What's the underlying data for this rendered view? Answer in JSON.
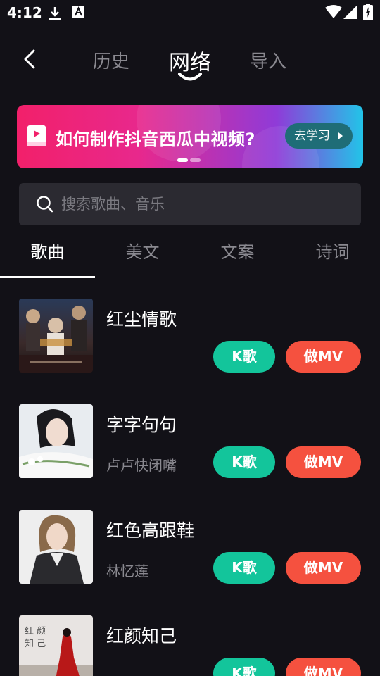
{
  "status_bar": {
    "time": "4:12",
    "icons": [
      "download-icon",
      "font-icon",
      "wifi-icon",
      "signal-icon",
      "battery-charging-icon"
    ]
  },
  "nav": {
    "back_icon": "back-icon",
    "tabs": [
      {
        "label": "历史",
        "active": false
      },
      {
        "label": "网络",
        "active": true
      },
      {
        "label": "导入",
        "active": false
      }
    ]
  },
  "banner": {
    "icon": "book-icon",
    "text": "如何制作抖音西瓜中视频?",
    "button_label": "去学习",
    "page_count": 2,
    "active_page": 1
  },
  "search": {
    "icon": "search-icon",
    "placeholder": "搜索歌曲、音乐"
  },
  "categories": {
    "tabs": [
      {
        "label": "歌曲",
        "active": true
      },
      {
        "label": "美文",
        "active": false
      },
      {
        "label": "文案",
        "active": false
      },
      {
        "label": "诗词",
        "active": false
      }
    ]
  },
  "songs": [
    {
      "title": "红尘情歌",
      "artist": "",
      "k_label": "K歌",
      "mv_label": "做MV"
    },
    {
      "title": "字字句句",
      "artist": "卢卢快闭嘴",
      "k_label": "K歌",
      "mv_label": "做MV"
    },
    {
      "title": "红色高跟鞋",
      "artist": "林忆莲",
      "k_label": "K歌",
      "mv_label": "做MV"
    },
    {
      "title": "红颜知己",
      "artist": "",
      "k_label": "K歌",
      "mv_label": "做MV",
      "cover_text": "红颜知己"
    }
  ],
  "colors": {
    "background": "#121117",
    "k_button": "#13c59b",
    "mv_button": "#f5513f",
    "search_bg": "#2b2a31",
    "inactive_text": "#8a8990"
  }
}
